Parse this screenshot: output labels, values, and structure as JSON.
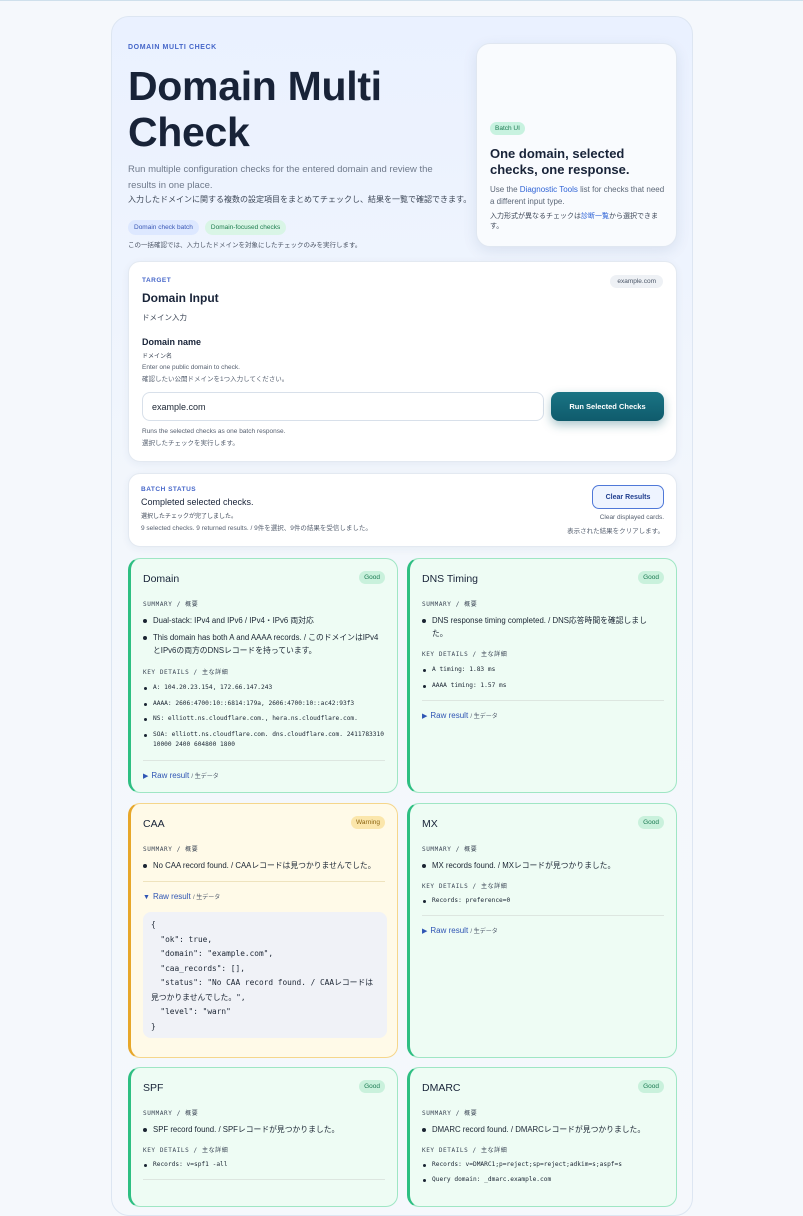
{
  "hero": {
    "eyebrow": "DOMAIN MULTI CHECK",
    "title": "Domain Multi Check",
    "desc_en": "Run multiple configuration checks for the entered domain and review the results in one place.",
    "desc_ja": "入力したドメインに関する複数の設定項目をまとめてチェックし、結果を一覧で確認できます。",
    "chip_batch": "Domain check batch",
    "chip_focused": "Domain-focused checks",
    "note": "この一括確認では、入力したドメインを対象にしたチェックのみを実行します。"
  },
  "side_card": {
    "badge": "Batch UI",
    "title": "One domain, selected checks, one response.",
    "text_before": "Use the ",
    "link": "Diagnostic Tools",
    "text_after": " list for checks that need a different input type.",
    "ja_before": "入力形式が異なるチェックは",
    "ja_link": "診断一覧",
    "ja_after": "から選択できます。"
  },
  "target": {
    "kicker": "TARGET",
    "badge": "example.com",
    "title": "Domain Input",
    "title_ja": "ドメイン入力",
    "field_label": "Domain name",
    "field_label_ja": "ドメイン名",
    "help_en": "Enter one public domain to check.",
    "help_ja": "確認したい公開ドメインを1つ入力してください。",
    "input_value": "example.com",
    "run_button": "Run Selected Checks",
    "run_help_en": "Runs the selected checks as one batch response.",
    "run_help_ja": "選択したチェックを実行します。"
  },
  "status": {
    "kicker": "BATCH STATUS",
    "title": "Completed selected checks.",
    "title_ja": "選択したチェックが完了しました。",
    "summary": "9 selected checks. 9 returned results. / 9件を選択、9件の結果を受信しました。",
    "clear_button": "Clear Results",
    "clear_help_en": "Clear displayed cards.",
    "clear_help_ja": "表示された結果をクリアします。"
  },
  "labels": {
    "summary": "SUMMARY / 概要",
    "key_details": "KEY DETAILS / 主な詳細",
    "raw": "Raw result",
    "raw_ja": "/ 生データ"
  },
  "results": {
    "domain": {
      "title": "Domain",
      "status": "Good",
      "summary": [
        "Dual-stack: IPv4 and IPv6 / IPv4・IPv6 両対応",
        "This domain has both A and AAAA records. / このドメインはIPv4とIPv6の両方のDNSレコードを持っています。"
      ],
      "details": [
        "A: 104.20.23.154, 172.66.147.243",
        "AAAA: 2606:4700:10::6814:179a, 2606:4700:10::ac42:93f3",
        "NS: elliott.ns.cloudflare.com., hera.ns.cloudflare.com.",
        "SOA: elliott.ns.cloudflare.com. dns.cloudflare.com. 2411783310 10000 2400 604800 1800"
      ]
    },
    "dns_timing": {
      "title": "DNS Timing",
      "status": "Good",
      "summary": [
        "DNS response timing completed. / DNS応答時間を確認しました。"
      ],
      "details": [
        "A timing: 1.83 ms",
        "AAAA timing: 1.57 ms"
      ]
    },
    "caa": {
      "title": "CAA",
      "status": "Warning",
      "summary": [
        "No CAA record found. / CAAレコードは見つかりませんでした。"
      ],
      "raw_json": "{\n  \"ok\": true,\n  \"domain\": \"example.com\",\n  \"caa_records\": [],\n  \"status\": \"No CAA record found. / CAAレコードは見つかりませんでした。\",\n  \"level\": \"warn\"\n}"
    },
    "mx": {
      "title": "MX",
      "status": "Good",
      "summary": [
        "MX records found. / MXレコードが見つかりました。"
      ],
      "details": [
        "Records: preference=0"
      ]
    },
    "spf": {
      "title": "SPF",
      "status": "Good",
      "summary": [
        "SPF record found. / SPFレコードが見つかりました。"
      ],
      "details": [
        "Records: v=spf1 -all"
      ]
    },
    "dmarc": {
      "title": "DMARC",
      "status": "Good",
      "summary": [
        "DMARC record found. / DMARCレコードが見つかりました。"
      ],
      "details": [
        "Records: v=DMARC1;p=reject;sp=reject;adkim=s;aspf=s",
        "Query domain: _dmarc.example.com"
      ]
    }
  },
  "colors": {
    "good_border": "#2ebf82",
    "warn_border": "#e7a72a",
    "accent": "#0f5b6c",
    "link": "#2f63d6"
  }
}
